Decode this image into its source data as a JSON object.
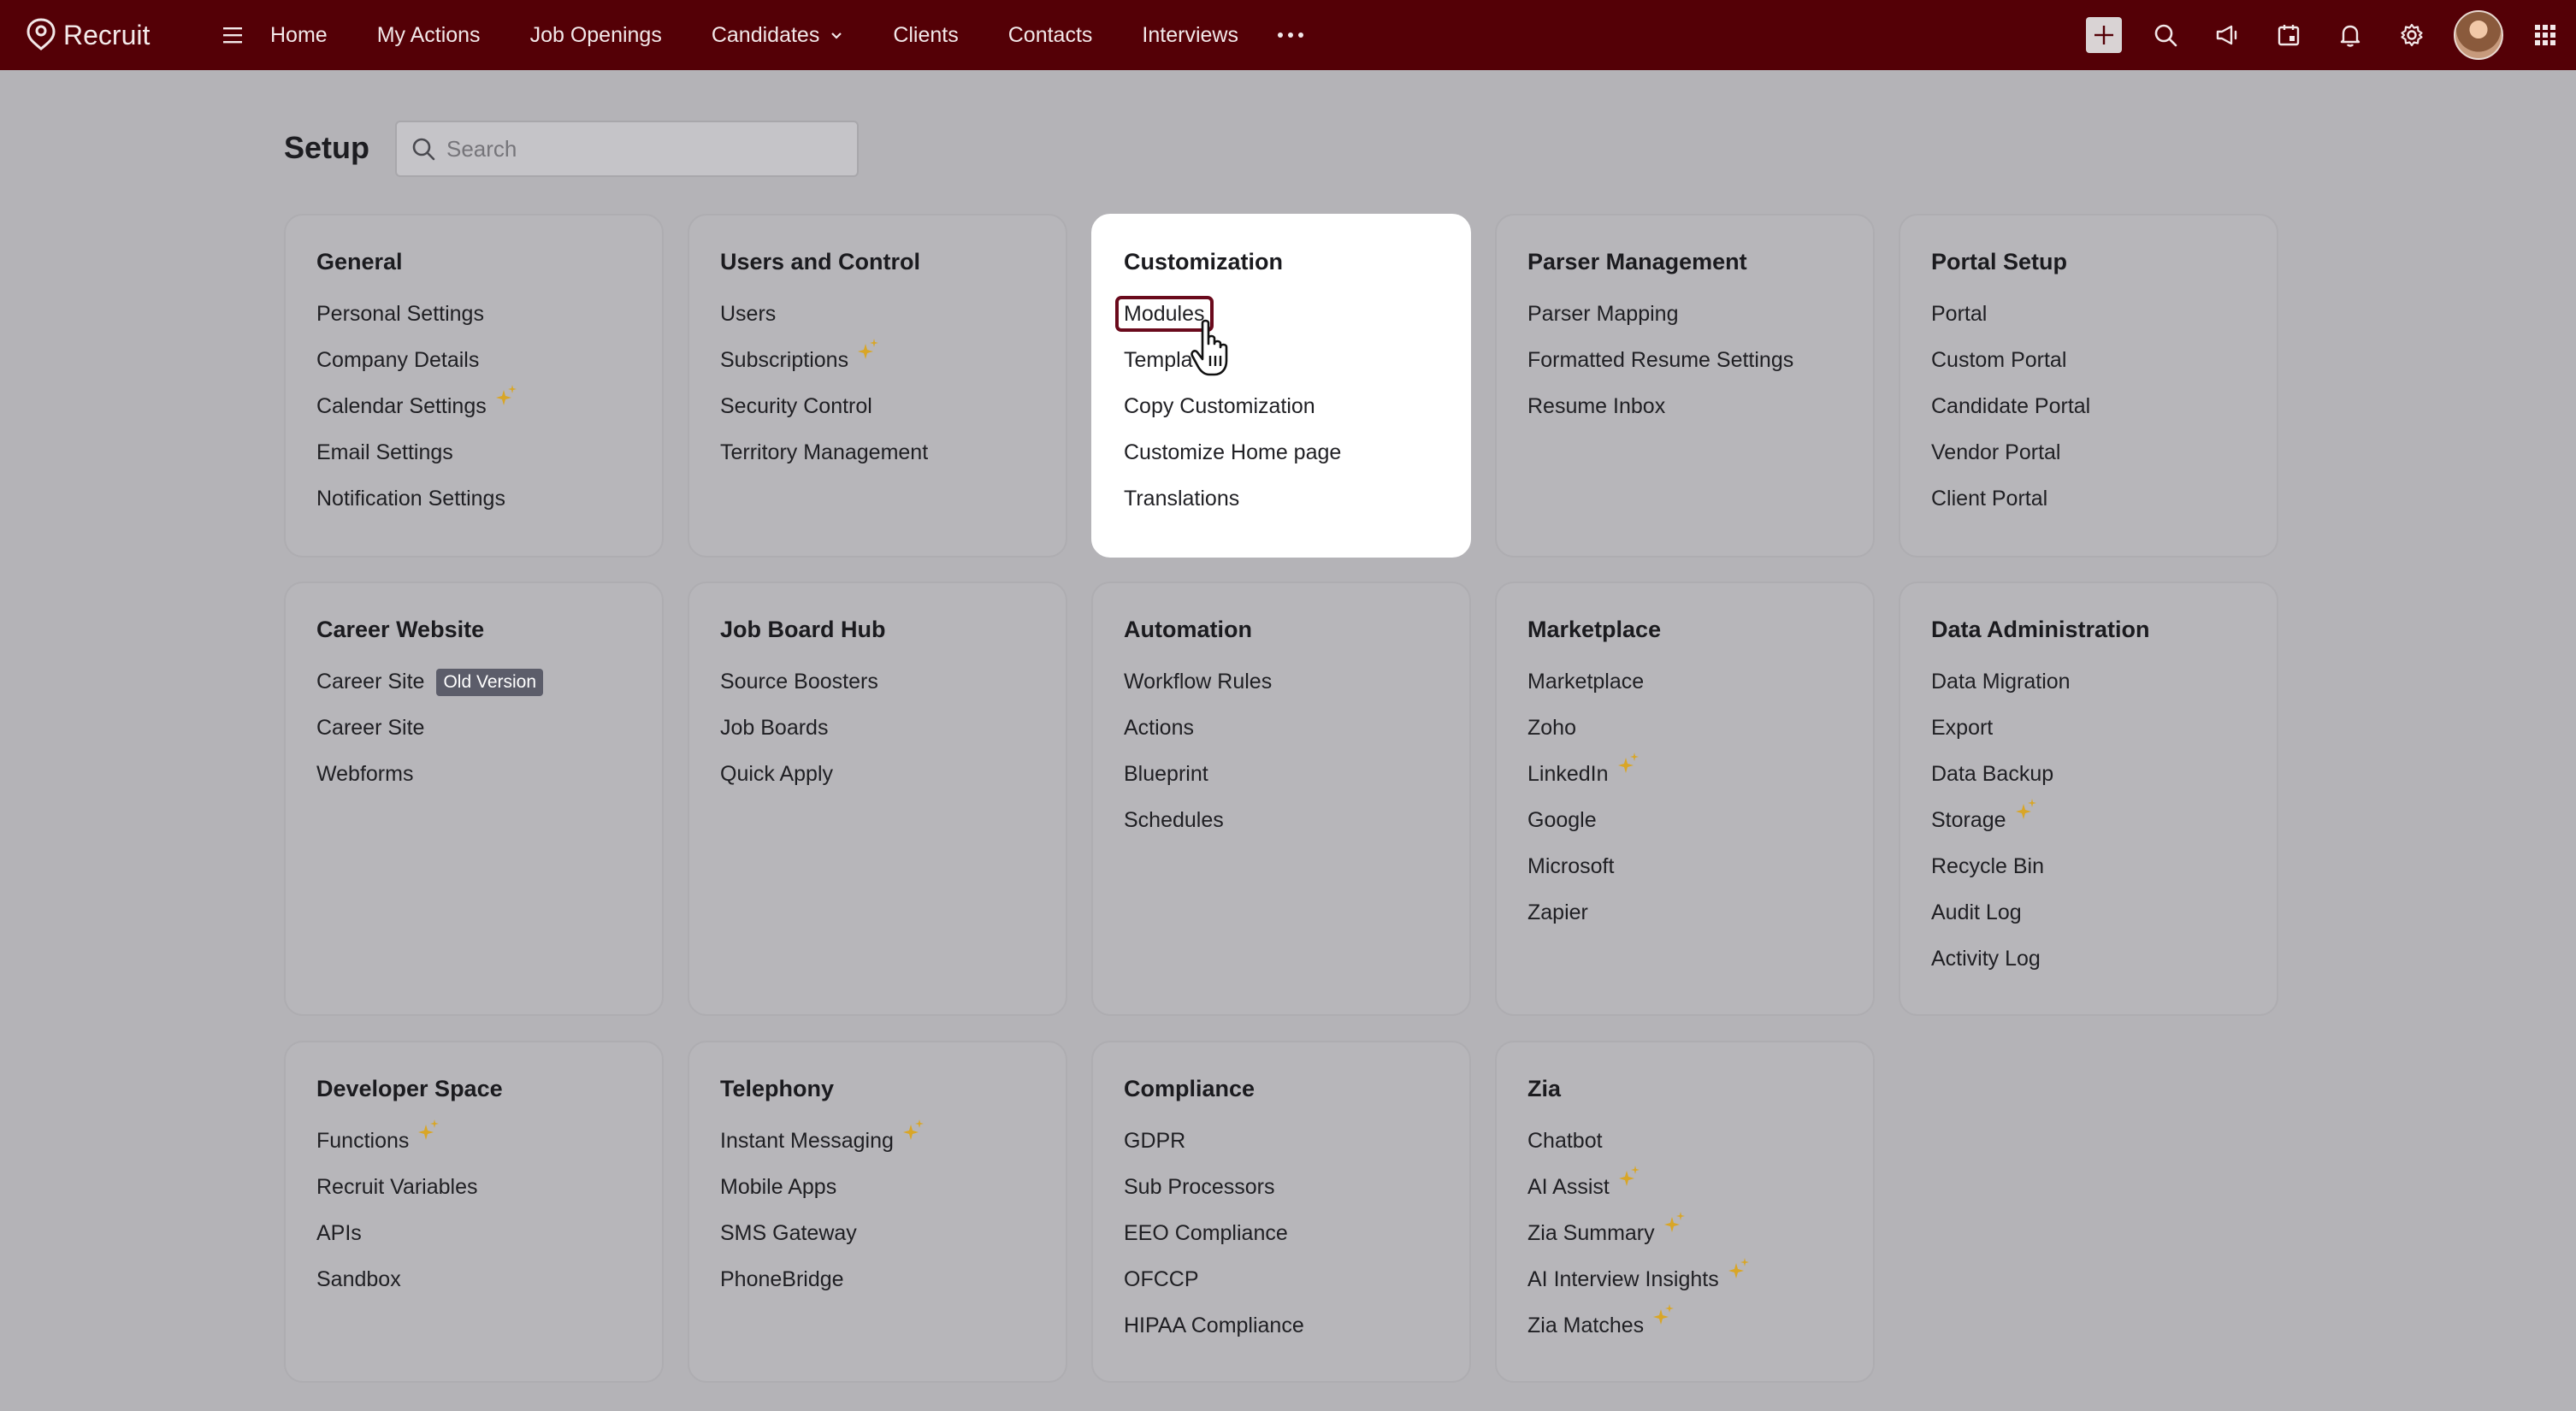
{
  "app": {
    "name": "Recruit"
  },
  "nav": {
    "items": [
      {
        "label": "Home"
      },
      {
        "label": "My Actions"
      },
      {
        "label": "Job Openings"
      },
      {
        "label": "Candidates",
        "dropdown": true
      },
      {
        "label": "Clients"
      },
      {
        "label": "Contacts"
      },
      {
        "label": "Interviews"
      }
    ],
    "more_icon": "more-dots-icon",
    "right_icons": [
      "plus-icon",
      "search-icon",
      "megaphone-icon",
      "calendar-icon",
      "bell-icon",
      "gear-icon",
      "avatar",
      "apps-grid-icon"
    ]
  },
  "setup": {
    "title": "Setup",
    "search_placeholder": "Search"
  },
  "cards": [
    {
      "title": "General",
      "items": [
        {
          "label": "Personal Settings"
        },
        {
          "label": "Company Details"
        },
        {
          "label": "Calendar Settings",
          "sparkle": true
        },
        {
          "label": "Email Settings"
        },
        {
          "label": "Notification Settings"
        }
      ]
    },
    {
      "title": "Users and Control",
      "items": [
        {
          "label": "Users"
        },
        {
          "label": "Subscriptions",
          "sparkle": true
        },
        {
          "label": "Security Control"
        },
        {
          "label": "Territory Management"
        }
      ]
    },
    {
      "title": "Customization",
      "active": true,
      "items": [
        {
          "label": "Modules",
          "highlighted": true
        },
        {
          "label": "Templa"
        },
        {
          "label": "Copy Customization"
        },
        {
          "label": "Customize Home page"
        },
        {
          "label": "Translations"
        }
      ]
    },
    {
      "title": "Parser Management",
      "items": [
        {
          "label": "Parser Mapping"
        },
        {
          "label": "Formatted Resume Settings"
        },
        {
          "label": "Resume Inbox"
        }
      ]
    },
    {
      "title": "Portal Setup",
      "items": [
        {
          "label": "Portal"
        },
        {
          "label": "Custom Portal"
        },
        {
          "label": "Candidate Portal"
        },
        {
          "label": "Vendor Portal"
        },
        {
          "label": "Client Portal"
        }
      ]
    },
    {
      "title": "Career Website",
      "items": [
        {
          "label": "Career Site",
          "badge": "Old Version"
        },
        {
          "label": "Career Site"
        },
        {
          "label": "Webforms"
        }
      ]
    },
    {
      "title": "Job Board Hub",
      "items": [
        {
          "label": "Source Boosters"
        },
        {
          "label": "Job Boards"
        },
        {
          "label": "Quick Apply"
        }
      ]
    },
    {
      "title": "Automation",
      "items": [
        {
          "label": "Workflow Rules"
        },
        {
          "label": "Actions"
        },
        {
          "label": "Blueprint"
        },
        {
          "label": "Schedules"
        }
      ]
    },
    {
      "title": "Marketplace",
      "items": [
        {
          "label": "Marketplace"
        },
        {
          "label": "Zoho"
        },
        {
          "label": "LinkedIn",
          "sparkle": true
        },
        {
          "label": "Google"
        },
        {
          "label": "Microsoft"
        },
        {
          "label": "Zapier"
        }
      ]
    },
    {
      "title": "Data Administration",
      "items": [
        {
          "label": "Data Migration"
        },
        {
          "label": "Export"
        },
        {
          "label": "Data Backup"
        },
        {
          "label": "Storage",
          "sparkle": true
        },
        {
          "label": "Recycle Bin"
        },
        {
          "label": "Audit Log"
        },
        {
          "label": "Activity Log"
        }
      ]
    },
    {
      "title": "Developer Space",
      "items": [
        {
          "label": "Functions",
          "sparkle": true
        },
        {
          "label": "Recruit Variables"
        },
        {
          "label": "APIs"
        },
        {
          "label": "Sandbox"
        }
      ]
    },
    {
      "title": "Telephony",
      "items": [
        {
          "label": "Instant Messaging",
          "sparkle": true
        },
        {
          "label": "Mobile Apps"
        },
        {
          "label": "SMS Gateway"
        },
        {
          "label": "PhoneBridge"
        }
      ]
    },
    {
      "title": "Compliance",
      "items": [
        {
          "label": "GDPR"
        },
        {
          "label": "Sub Processors"
        },
        {
          "label": "EEO Compliance"
        },
        {
          "label": "OFCCP"
        },
        {
          "label": "HIPAA Compliance"
        }
      ]
    },
    {
      "title": "Zia",
      "items": [
        {
          "label": "Chatbot"
        },
        {
          "label": "AI Assist",
          "sparkle": true
        },
        {
          "label": "Zia Summary",
          "sparkle": true
        },
        {
          "label": "AI Interview Insights",
          "sparkle": true
        },
        {
          "label": "Zia Matches",
          "sparkle": true
        }
      ]
    }
  ],
  "colors": {
    "topbar": "#540006",
    "background": "#b4b3b7",
    "card": "#b7b6ba",
    "card_active": "#ffffff",
    "highlight_border": "#6a0a1c",
    "sparkle": "#d9a626",
    "badge": "#5c5d6a"
  }
}
